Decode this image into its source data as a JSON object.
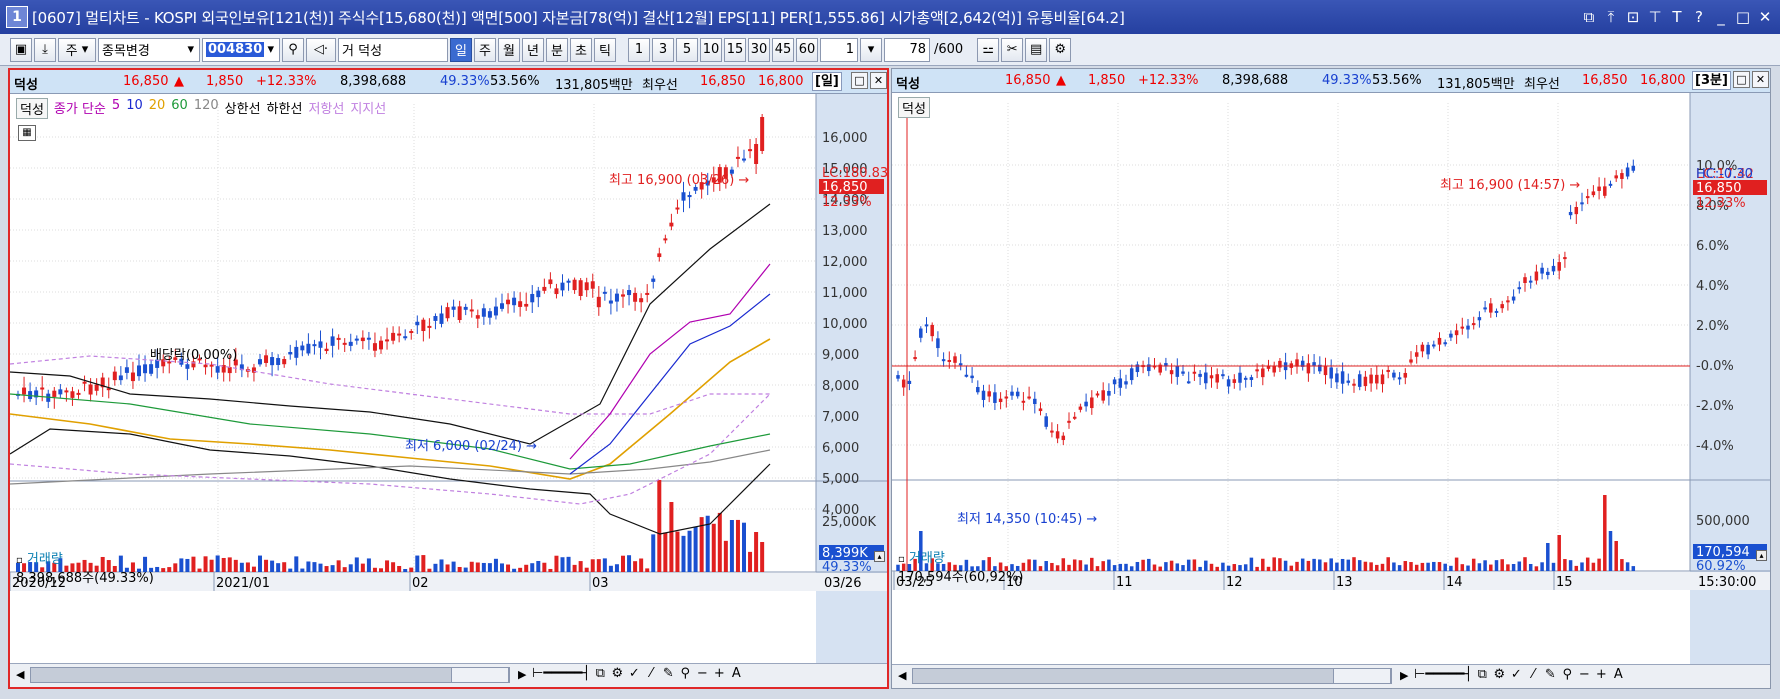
{
  "window": {
    "number": "1",
    "title": "[0607] 멀티차트 - KOSPI 외국인보유[121(천)] 주식수[15,680(천)] 액면[500] 자본금[78(억)] 결산[12월] EPS[11] PER[1,555.86] 시가총액[2,642(억)] 유통비율[64.2]",
    "controls": [
      "⧉",
      "⤒",
      "⊡",
      "⊤",
      "T",
      "?",
      "_",
      "□",
      "✕"
    ]
  },
  "toolbar": {
    "mode_label": "주",
    "change_label": "종목변경",
    "stock_code": "004830",
    "stock_prefix": "거",
    "stock_name": "덕성",
    "periods": [
      "일",
      "주",
      "월",
      "년",
      "분",
      "초",
      "틱"
    ],
    "intervals": [
      "1",
      "3",
      "5",
      "10",
      "15",
      "30",
      "45",
      "60"
    ],
    "interval_value": "1",
    "page_value": "78",
    "page_total": "/600"
  },
  "left_pane": {
    "info": {
      "name": "덕성",
      "price": "16,850",
      "arrow": "▲",
      "change": "1,850",
      "change_pct": "+12.33%",
      "volume": "8,398,688",
      "vol_pct": "49.33%",
      "ratio": "53.56%",
      "amount": "131,805백만",
      "best_label": "최우선",
      "bid": "16,850",
      "ask": "16,800",
      "period": "[일]"
    },
    "legend": {
      "stock": "덕성",
      "ma_label": "종가 단순",
      "ma": [
        {
          "label": "5",
          "color": "#b000b0"
        },
        {
          "label": "10",
          "color": "#1a2ad0"
        },
        {
          "label": "20",
          "color": "#e0a000"
        },
        {
          "label": "60",
          "color": "#1e9a3a"
        },
        {
          "label": "120",
          "color": "#888888"
        }
      ],
      "upper": "상한선",
      "lower": "하한선",
      "resist": "저항선",
      "support": "지지선"
    },
    "annotations": {
      "high": "최고 16,900 (03/26)",
      "low": "최저 6,000 (02/24)",
      "dividend": "배당락(0.00%)"
    },
    "y_axis": {
      "ticks": [
        "16,000",
        "15,000",
        "14,000",
        "13,000",
        "12,000",
        "11,000",
        "10,000",
        "9,000",
        "8,000",
        "7,000",
        "6,000",
        "5,000",
        "4,000"
      ],
      "lc": "LC:180.83",
      "hc": "H",
      "price_tag": "16,850",
      "pct": "12.33%"
    },
    "volume": {
      "title": "거래량",
      "value": "8,398,688주(49.33%)",
      "tick": "25,000K",
      "tag": "8,399K",
      "tag_pct": "49.33%"
    },
    "x_axis": {
      "labels": [
        "2020/12",
        "2021/01",
        "02",
        "03"
      ],
      "end": "03/26"
    }
  },
  "right_pane": {
    "info": {
      "name": "덕성",
      "price": "16,850",
      "arrow": "▲",
      "change": "1,850",
      "change_pct": "+12.33%",
      "volume": "8,398,688",
      "vol_pct": "49.33%",
      "ratio": "53.56%",
      "amount": "131,805백만",
      "best_label": "최우선",
      "bid": "16,850",
      "ask": "16,800",
      "period": "[3분]"
    },
    "legend": {
      "stock": "덕성"
    },
    "annotations": {
      "high": "최고 16,900 (14:57)",
      "low": "최저 14,350 (10:45)"
    },
    "y_axis": {
      "ticks": [
        "10.0%",
        "8.0%",
        "6.0%",
        "4.0%",
        "2.0%",
        "-0.0%",
        "-2.0%",
        "-4.0%"
      ],
      "lc": "LC:17.42",
      "hc": "HC:-0.30",
      "price_tag": "16,850",
      "pct": "12.33%"
    },
    "volume": {
      "title": "거래량",
      "value": "170,594주(60,92%)",
      "tick": "500,000",
      "tag": "170,594",
      "tag_pct": "60.92%"
    },
    "x_axis": {
      "labels": [
        "03/25",
        "10",
        "11",
        "12",
        "13",
        "14",
        "15"
      ],
      "end": "15:30:00"
    }
  },
  "colors": {
    "up": "#e02020",
    "down": "#1a50d0",
    "grid": "#d0d0d0",
    "title_bg": "#2f4cab"
  },
  "icons": [
    "window-number-icon",
    "layout-icon",
    "download-icon",
    "search-icon",
    "speaker-icon",
    "grid-icon",
    "settings-icon",
    "scroll-left-icon",
    "scroll-right-icon",
    "zoom-icon"
  ]
}
